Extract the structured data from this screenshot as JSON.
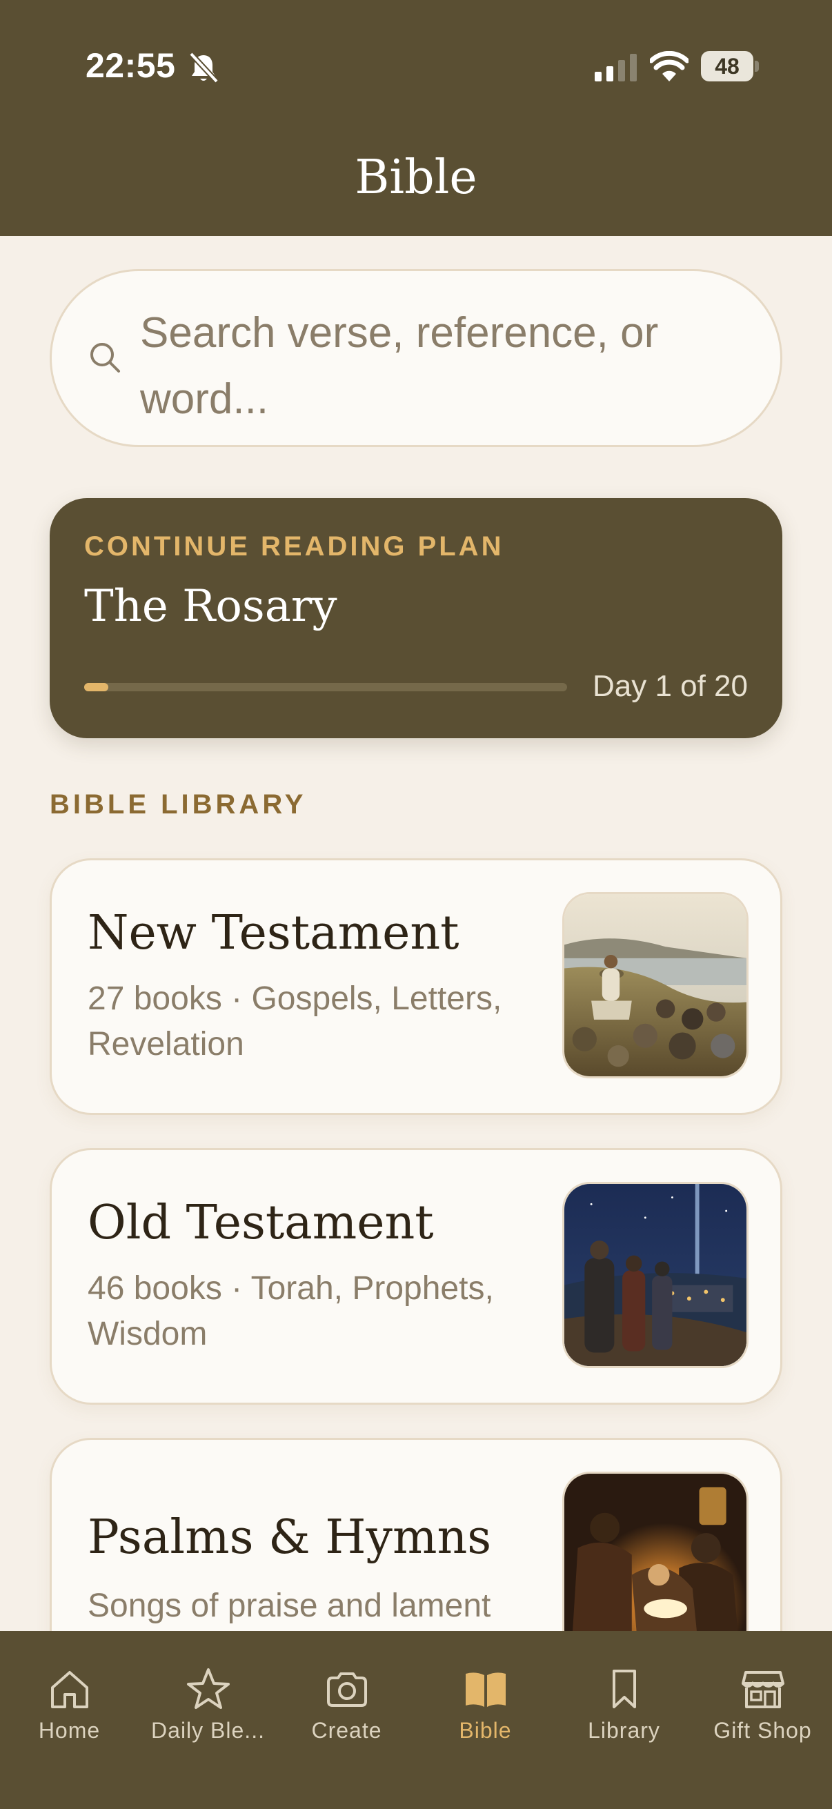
{
  "status_bar": {
    "time": "22:55",
    "battery": "48"
  },
  "header": {
    "title": "Bible"
  },
  "search": {
    "placeholder": "Search verse, reference, or word..."
  },
  "reading_plan": {
    "eyebrow": "CONTINUE READING PLAN",
    "title": "The Rosary",
    "day_text": "Day 1 of 20",
    "progress_fraction": 0.05
  },
  "library": {
    "heading": "BIBLE LIBRARY",
    "items": [
      {
        "title": "New Testament",
        "description": "27 books · Gospels, Letters, Revelation"
      },
      {
        "title": "Old Testament",
        "description": "46 books · Torah, Prophets, Wisdom"
      },
      {
        "title": "Psalms & Hymns",
        "description": "Songs of praise and lament"
      }
    ]
  },
  "tabbar": {
    "items": [
      {
        "label": "Home",
        "icon": "home-icon"
      },
      {
        "label": "Daily Ble...",
        "icon": "star-icon"
      },
      {
        "label": "Create",
        "icon": "camera-icon"
      },
      {
        "label": "Bible",
        "icon": "book-icon",
        "active": true
      },
      {
        "label": "Library",
        "icon": "bookmark-icon"
      },
      {
        "label": "Gift Shop",
        "icon": "storefront-icon"
      }
    ]
  },
  "colors": {
    "header_bg": "#5a4f33",
    "page_bg": "#f6f0e8",
    "accent": "#e3b66a",
    "section_heading": "#8b6a32"
  }
}
